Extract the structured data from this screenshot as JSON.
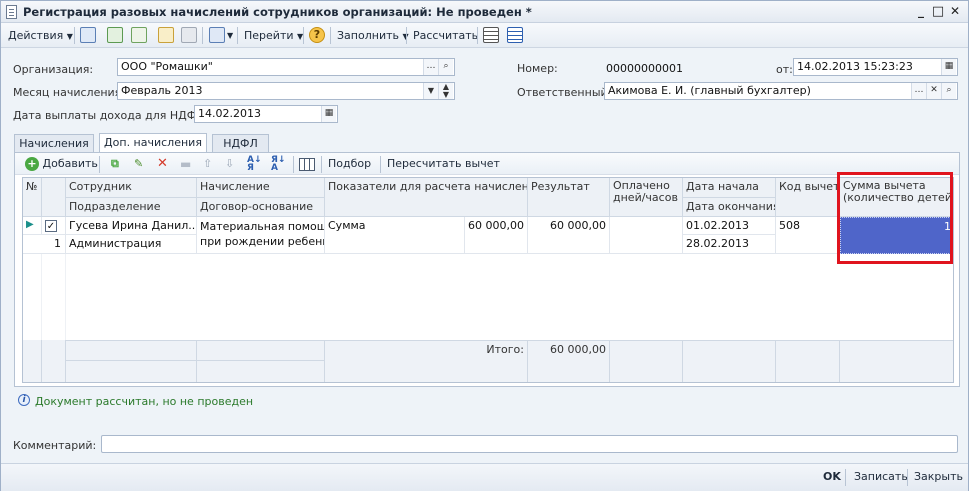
{
  "window": {
    "title": "Регистрация разовых начислений сотрудников организаций: Не проведен *",
    "controls": {
      "minimize": "_",
      "maximize": "□",
      "close": "✕"
    }
  },
  "toolbar": {
    "actions_label": "Действия",
    "goto_label": "Перейти",
    "fill_label": "Заполнить",
    "calculate_label": "Рассчитать"
  },
  "form": {
    "org_label": "Организация:",
    "org_value": "ООО \"Ромашки\"",
    "month_label": "Месяц начисления:",
    "month_value": "Февраль 2013",
    "ndfl_date_label": "Дата выплаты дохода для НДФЛ:",
    "ndfl_date_value": "14.02.2013",
    "number_label": "Номер:",
    "number_value": "00000000001",
    "from_label": "от:",
    "date_value": "14.02.2013 15:23:23",
    "responsible_label": "Ответственный:",
    "responsible_value": "Акимова Е. И. (главный бухгалтер)"
  },
  "tabs": [
    {
      "label": "Начисления"
    },
    {
      "label": "Доп. начисления"
    },
    {
      "label": "НДФЛ"
    }
  ],
  "panel_toolbar": {
    "add_label": "Добавить",
    "select_label": "Подбор",
    "recalc_label": "Пересчитать вычет"
  },
  "table": {
    "headers": {
      "num": "№",
      "employee": "Сотрудник",
      "department": "Подразделение",
      "accrual": "Начисление",
      "contract": "Договор-основание",
      "indicators": "Показатели для расчета начисления",
      "result": "Результат",
      "paid_line1": "Оплачено",
      "paid_line2": "дней/часов",
      "start_date": "Дата начала",
      "end_date": "Дата окончания",
      "deduction_code": "Код вычета",
      "deduction_sum_line1": "Сумма вычета",
      "deduction_sum_line2": "(количество детей)"
    },
    "rows": [
      {
        "num": "1",
        "employee": "Гусева Ирина Данил...",
        "department": "Администрация",
        "accrual_line1": "Материальная помощь",
        "accrual_line2": "при рождении ребенка",
        "indicator_name": "Сумма",
        "indicator_value": "60 000,00",
        "result": "60 000,00",
        "start_date": "01.02.2013",
        "end_date": "28.02.2013",
        "deduction_code": "508",
        "deduction_sum": "1"
      }
    ],
    "footer": {
      "total_label": "Итого:",
      "total_value": "60 000,00"
    }
  },
  "status": {
    "info_text": "Документ рассчитан, но не проведен"
  },
  "comment": {
    "label": "Комментарий:",
    "value": ""
  },
  "buttons": {
    "ok": "OK",
    "save": "Записать",
    "close": "Закрыть"
  },
  "colors": {
    "selected_cell": "#4f65c9",
    "highlight": "#e0141e",
    "info_text": "#2b7a2b"
  }
}
